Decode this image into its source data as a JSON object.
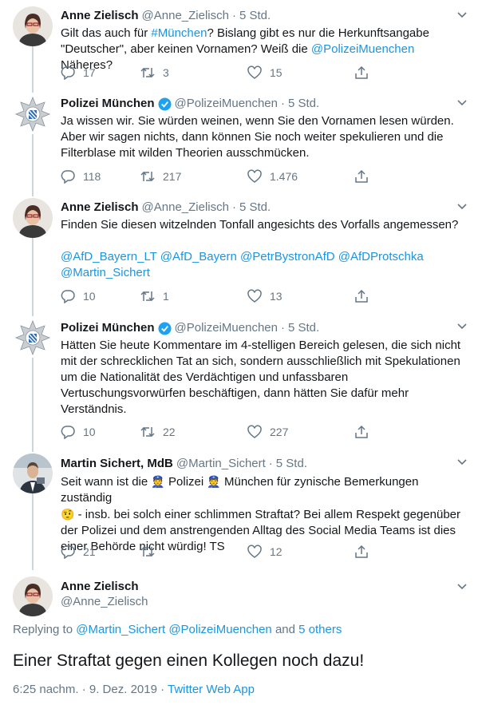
{
  "colors": {
    "link": "#1b95e0",
    "muted": "#657786",
    "verified": "#1da1f2",
    "line": "#ccd6dd"
  },
  "tweets": [
    {
      "name": "Anne Zielisch",
      "handle": "@Anne_Zielisch",
      "time": "5 Std.",
      "text_a": "Gilt das auch für ",
      "link_a": "#München",
      "text_b": "? Bislang gibt es nur die Herkunftsangabe\n\"Deutscher\", aber keinen Vornamen? Weiß die ",
      "link_b": "@PolizeiMuenchen",
      "text_c": " Näheres?",
      "replies": "17",
      "retweets": "3",
      "likes": "15"
    },
    {
      "name": "Polizei München",
      "handle": "@PolizeiMuenchen",
      "time": "5 Std.",
      "text": "Ja wissen wir. Sie würden weinen, wenn Sie den Vornamen lesen würden.\nAber wir sagen nichts, dann können Sie noch weiter spekulieren und die\nFilterblase mit wilden Theorien ausschmücken.",
      "replies": "118",
      "retweets": "217",
      "likes": "1.476"
    },
    {
      "name": "Anne Zielisch",
      "handle": "@Anne_Zielisch",
      "time": "5 Std.",
      "text": "Finden Sie diesen witzelnden Tonfall angesichts des Vorfalls angemessen?",
      "mentions_line1": "@AfD_Bayern_LT @AfD_Bayern @PetrBystronAfD @AfDProtschka",
      "mentions_line2": "@Martin_Sichert",
      "replies": "10",
      "retweets": "1",
      "likes": "13"
    },
    {
      "name": "Polizei München",
      "handle": "@PolizeiMuenchen",
      "time": "5 Std.",
      "text": "Hätten Sie heute Kommentare im 4-stelligen Bereich gelesen, die sich nicht\nmit der schrecklichen Tat an sich, sondern ausschließlich mit Spekulationen\num die Nationalität des Verdächtigen und unfassbaren\nVertuschungsvorwürfen beschäftigen, dann hätten Sie dafür mehr\nVerständnis.",
      "replies": "10",
      "retweets": "22",
      "likes": "227"
    },
    {
      "name": "Martin Sichert, MdB",
      "handle": "@Martin_Sichert",
      "time": "5 Std.",
      "text_a": "Seit wann ist die ",
      "emoji_a": "👮",
      "text_b": " Polizei ",
      "emoji_b": "👮",
      "text_c": " München für zynische Bemerkungen zuständig\n",
      "emoji_c": "🤨",
      "text_d": " - insb. bei solch einer schlimmen Straftat? Bei allem Respekt gegenüber\nder Polizei und dem anstrengenden Alltag des Social Media Teams ist dies\neiner Behörde nicht würdig! TS",
      "replies": "21",
      "retweets": "",
      "likes": "12"
    }
  ],
  "focus": {
    "name": "Anne Zielisch",
    "handle": "@Anne_Zielisch",
    "replying_prefix": "Replying to ",
    "replying_users": "@Martin_Sichert @PolizeiMuenchen",
    "replying_and": " and ",
    "replying_others": "5 others",
    "text": "Einer Straftat gegen einen Kollegen noch dazu!",
    "timestamp": "6:25 nachm. · 9. Dez. 2019 · ",
    "app": "Twitter Web App"
  }
}
